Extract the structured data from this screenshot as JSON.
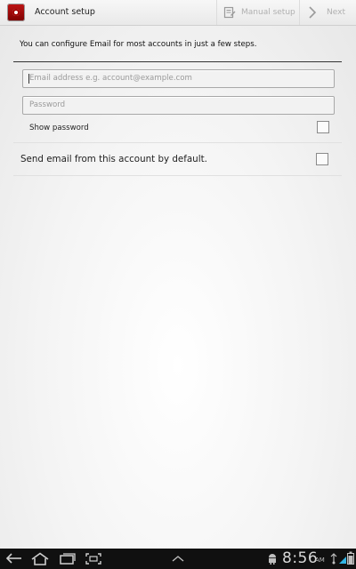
{
  "actionbar": {
    "title": "Account setup",
    "manual_setup_label": "Manual setup",
    "next_label": "Next"
  },
  "form": {
    "intro": "You can configure Email for most accounts in just a few steps.",
    "email_placeholder": "Email address e.g. account@example.com",
    "password_placeholder": "Password",
    "show_password_label": "Show password",
    "show_password_checked": false,
    "default_label": "Send email from this account by default.",
    "default_checked": false
  },
  "navbar": {
    "time": "8:56",
    "ampm": "AM",
    "icons": [
      "back-icon",
      "home-icon",
      "recent-apps-icon",
      "screenshot-icon",
      "chevron-up-icon",
      "android-icon",
      "usb-icon",
      "wifi-icon",
      "battery-icon"
    ]
  },
  "colors": {
    "accent": "#333333",
    "app_icon": "#b01010",
    "navbar": "#101010"
  }
}
